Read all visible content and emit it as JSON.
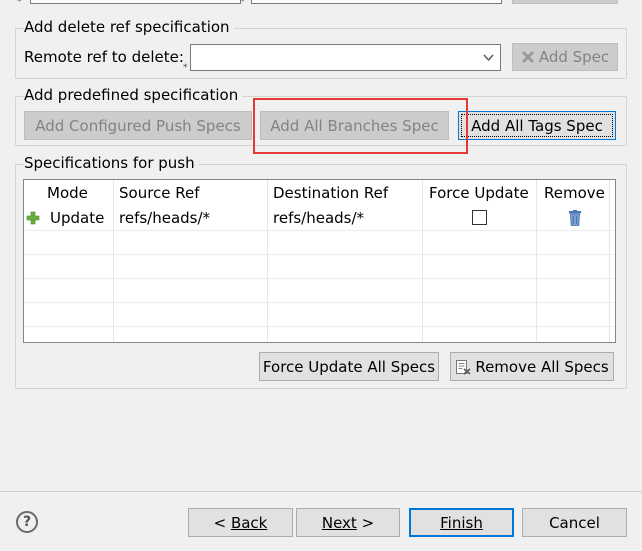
{
  "delete_group": {
    "legend": "Add delete ref specification",
    "remote_label": "Remote ref to delete:",
    "remote_value": "",
    "add_spec_label": "Add Spec"
  },
  "predefined_group": {
    "legend": "Add predefined specification",
    "configured_label": "Add Configured Push Specs",
    "branches_label": "Add All Branches Spec",
    "tags_label": "Add All Tags Spec"
  },
  "specs_group": {
    "legend": "Specifications for push",
    "columns": [
      "Mode",
      "Source Ref",
      "Destination Ref",
      "Force Update",
      "Remove"
    ],
    "rows": [
      {
        "mode": "Update",
        "source": "refs/heads/*",
        "destination": "refs/heads/*",
        "force": false
      }
    ],
    "force_all_label": "Force Update All Specs",
    "remove_all_label": "Remove All Specs"
  },
  "footer": {
    "back_label": "Back",
    "next_label": "Next",
    "finish_label": "Finish",
    "cancel_label": "Cancel"
  },
  "colors": {
    "highlight_box": "#e53935",
    "add_icon": "#6ab03a",
    "trash_icon": "#4a78b5",
    "focus_border": "#0078d7"
  }
}
